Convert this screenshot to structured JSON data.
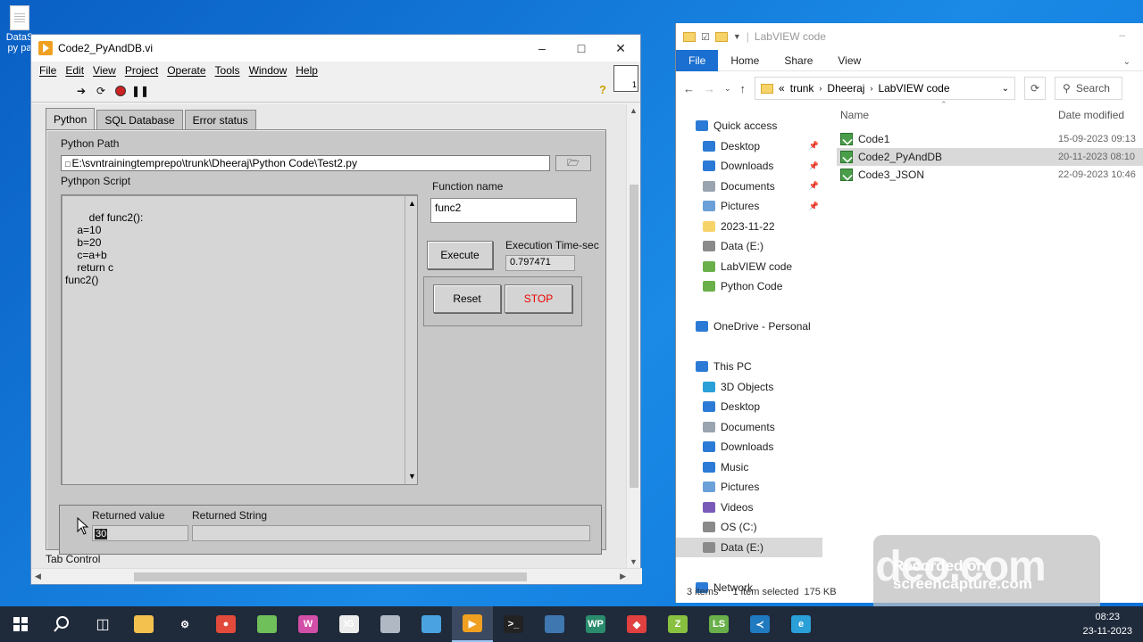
{
  "desktop": {
    "icon_label_1": "DataS",
    "icon_label_2": "py pa"
  },
  "labview": {
    "title": "Code2_PyAndDB.vi",
    "menu": [
      "File",
      "Edit",
      "View",
      "Project",
      "Operate",
      "Tools",
      "Window",
      "Help"
    ],
    "connector": "1",
    "tabs": [
      "Python",
      "SQL Database",
      "Error status"
    ],
    "python_path_label": "Python Path",
    "python_path_value": "E:\\svntrainingtemprepo\\trunk\\Dheeraj\\Python Code\\Test2.py",
    "python_script_label": "Pythpon Script",
    "python_script_value": "def func2():\n    a=10\n    b=20\n    c=a+b\n    return c\nfunc2()",
    "function_name_label": "Function name",
    "function_name_value": "func2",
    "execute_label": "Execute",
    "exec_time_label": "Execution Time-sec",
    "exec_time_value": "0.797471",
    "reset_label": "Reset",
    "stop_label": "STOP",
    "returned_value_label": "Returned value",
    "returned_value": "30",
    "returned_string_label": "Returned String",
    "returned_string_value": "",
    "tab_control_label": "Tab Control"
  },
  "explorer": {
    "title": "LabVIEW code",
    "ribbon": [
      "File",
      "Home",
      "Share",
      "View"
    ],
    "breadcrumb": [
      "trunk",
      "Dheeraj",
      "LabVIEW code"
    ],
    "breadcrumb_prefix": "«",
    "search_placeholder": "Search",
    "nav": [
      {
        "label": "Quick access",
        "icon": "star-icon",
        "pinned": false,
        "indent": 0
      },
      {
        "label": "Desktop",
        "icon": "desktop-icon",
        "pinned": true,
        "indent": 1
      },
      {
        "label": "Downloads",
        "icon": "download-icon",
        "pinned": true,
        "indent": 1
      },
      {
        "label": "Documents",
        "icon": "document-icon",
        "pinned": true,
        "indent": 1
      },
      {
        "label": "Pictures",
        "icon": "pictures-icon",
        "pinned": true,
        "indent": 1
      },
      {
        "label": "2023-11-22",
        "icon": "folder-icon",
        "pinned": false,
        "indent": 1
      },
      {
        "label": "Data (E:)",
        "icon": "drive-icon",
        "pinned": false,
        "indent": 1
      },
      {
        "label": "LabVIEW code",
        "icon": "vi-folder-icon",
        "pinned": false,
        "indent": 1
      },
      {
        "label": "Python Code",
        "icon": "vi-folder-icon",
        "pinned": false,
        "indent": 1
      },
      {
        "label": "",
        "icon": "",
        "pinned": false,
        "indent": 0
      },
      {
        "label": "OneDrive - Personal",
        "icon": "cloud-icon",
        "pinned": false,
        "indent": 0
      },
      {
        "label": "",
        "icon": "",
        "pinned": false,
        "indent": 0
      },
      {
        "label": "This PC",
        "icon": "pc-icon",
        "pinned": false,
        "indent": 0
      },
      {
        "label": "3D Objects",
        "icon": "cube-icon",
        "pinned": false,
        "indent": 1
      },
      {
        "label": "Desktop",
        "icon": "desktop-icon",
        "pinned": false,
        "indent": 1
      },
      {
        "label": "Documents",
        "icon": "document-icon",
        "pinned": false,
        "indent": 1
      },
      {
        "label": "Downloads",
        "icon": "download-icon",
        "pinned": false,
        "indent": 1
      },
      {
        "label": "Music",
        "icon": "music-icon",
        "pinned": false,
        "indent": 1
      },
      {
        "label": "Pictures",
        "icon": "pictures-icon",
        "pinned": false,
        "indent": 1
      },
      {
        "label": "Videos",
        "icon": "video-icon",
        "pinned": false,
        "indent": 1
      },
      {
        "label": "OS (C:)",
        "icon": "drive-icon",
        "pinned": false,
        "indent": 1
      },
      {
        "label": "Data (E:)",
        "icon": "drive-icon",
        "pinned": false,
        "indent": 1,
        "selected": true
      },
      {
        "label": "",
        "icon": "",
        "pinned": false,
        "indent": 0
      },
      {
        "label": "Network",
        "icon": "network-icon",
        "pinned": false,
        "indent": 0
      }
    ],
    "columns": [
      "Name",
      "Date modified"
    ],
    "files": [
      {
        "name": "Code1",
        "date": "15-09-2023 09:13"
      },
      {
        "name": "Code2_PyAndDB",
        "date": "20-11-2023 08:10",
        "selected": true
      },
      {
        "name": "Code3_JSON",
        "date": "22-09-2023 10:46"
      }
    ],
    "status_items": "3 items",
    "status_selected": "1 item selected",
    "status_size": "175 KB"
  },
  "watermark": {
    "brand": "clideo.com",
    "recorded": "Recorded on",
    "source": "screencapture.com"
  },
  "taskbar": {
    "time": "08:23",
    "date": "23-11-2023",
    "apps": [
      {
        "name": "file-explorer-icon",
        "color": "#f2c14e",
        "text": ""
      },
      {
        "name": "settings-icon",
        "color": "#1f2a3b",
        "text": "⚙"
      },
      {
        "name": "chrome-icon",
        "color": "#e24a3b",
        "text": "●"
      },
      {
        "name": "notepad-plus-icon",
        "color": "#6fbf5a",
        "text": ""
      },
      {
        "name": "wps-icon",
        "color": "#d24fa8",
        "text": "W"
      },
      {
        "name": "ig-icon",
        "color": "#ececec",
        "text": "IG"
      },
      {
        "name": "remote-icon",
        "color": "#b0b8c4",
        "text": ""
      },
      {
        "name": "app-icon",
        "color": "#4aa3e0",
        "text": ""
      },
      {
        "name": "labview-icon",
        "color": "#f0a020",
        "text": "▶",
        "active": true
      },
      {
        "name": "terminal-icon",
        "color": "#222",
        "text": ">_"
      },
      {
        "name": "python-icon",
        "color": "#3f77b0",
        "text": ""
      },
      {
        "name": "wp-icon",
        "color": "#2a8c6c",
        "text": "WP"
      },
      {
        "name": "anydesk-icon",
        "color": "#e04040",
        "text": "◆"
      },
      {
        "name": "z-icon",
        "color": "#88c040",
        "text": "Z"
      },
      {
        "name": "ls-icon",
        "color": "#6ab04a",
        "text": "LS"
      },
      {
        "name": "vscode-icon",
        "color": "#1f7ac0",
        "text": "≺"
      },
      {
        "name": "edge-icon",
        "color": "#2a9fd8",
        "text": "e"
      }
    ]
  }
}
